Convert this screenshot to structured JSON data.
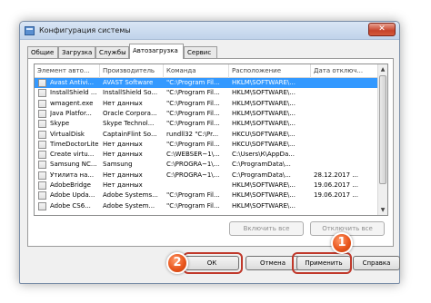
{
  "window": {
    "title": "Конфигурация системы",
    "close_glyph": "✕"
  },
  "tabs": [
    {
      "label": "Общие"
    },
    {
      "label": "Загрузка"
    },
    {
      "label": "Службы"
    },
    {
      "label": "Автозагрузка",
      "active": true
    },
    {
      "label": "Сервис"
    }
  ],
  "table": {
    "columns": [
      "Элемент авто...",
      "Производитель",
      "Команда",
      "Расположение",
      "Дата отключ..."
    ],
    "rows": [
      {
        "item": "Avast Antivi...",
        "maker": "AVAST Software",
        "command": "\"C:\\Program Fil...",
        "location": "HKLM\\SOFTWARE\\...",
        "date": "",
        "selected": true
      },
      {
        "item": "InstallShield ...",
        "maker": "InstallShield So...",
        "command": "\"C:\\Program Fil...",
        "location": "HKLM\\SOFTWARE\\...",
        "date": ""
      },
      {
        "item": "wmagent.exe",
        "maker": "Нет данных",
        "command": "\"C:\\Program Fil...",
        "location": "HKLM\\SOFTWARE\\...",
        "date": ""
      },
      {
        "item": "Java Platfor...",
        "maker": "Oracle Corpora...",
        "command": "\"C:\\Program Fil...",
        "location": "HKLM\\SOFTWARE\\...",
        "date": ""
      },
      {
        "item": "Skype",
        "maker": "Skype Technol...",
        "command": "\"C:\\Program Fil...",
        "location": "HKLM\\SOFTWARE\\...",
        "date": ""
      },
      {
        "item": "VirtualDisk",
        "maker": "CaptainFlint So...",
        "command": "rundll32 \"C:\\Pr...",
        "location": "HKCU\\SOFTWARE\\...",
        "date": ""
      },
      {
        "item": "TimeDoctorLite",
        "maker": "Нет данных",
        "command": "\"C:\\Program Fil...",
        "location": "HKCU\\SOFTWARE\\...",
        "date": ""
      },
      {
        "item": "Create virtu...",
        "maker": "Нет данных",
        "command": "C:\\WEBSER~1\\...",
        "location": "C:\\Users\\К\\AppDa...",
        "date": ""
      },
      {
        "item": "Samsung NC...",
        "maker": "Samsung",
        "command": "C:\\PROGRA~1\\...",
        "location": "C:\\ProgramData\\...",
        "date": ""
      },
      {
        "item": "Утилита на...",
        "maker": "Нет данных",
        "command": "C:\\PROGRA~1\\...",
        "location": "C:\\ProgramData\\...",
        "date": "28.12.2017 ..."
      },
      {
        "item": "AdobeBridge",
        "maker": "Нет данных",
        "command": "",
        "location": "HKLM\\SOFTWARE\\...",
        "date": "19.06.2017 ..."
      },
      {
        "item": "Adobe Upda...",
        "maker": "Adobe Systems...",
        "command": "\"C:\\Program Fil...",
        "location": "HKLM\\SOFTWARE\\...",
        "date": "19.06.2017 ..."
      },
      {
        "item": "Adobe CS6...",
        "maker": "Adobe System...",
        "command": "\"C:\\Program Fil...",
        "location": "HKLM\\SOFTWARE\\...",
        "date": ""
      }
    ]
  },
  "buttons": {
    "enable_all": "Включить все",
    "disable_all": "Отключить все",
    "ok": "ОК",
    "cancel": "Отмена",
    "apply": "Применить",
    "help": "Справка"
  },
  "annotations": {
    "badge1": "1",
    "badge2": "2",
    "highlight_color": "#c0392b",
    "badge_color": "#e9561d"
  },
  "colors": {
    "selection": "#3399ff",
    "titlebar": "#c0d3ea",
    "dialog_bg": "#f0f0f0"
  }
}
